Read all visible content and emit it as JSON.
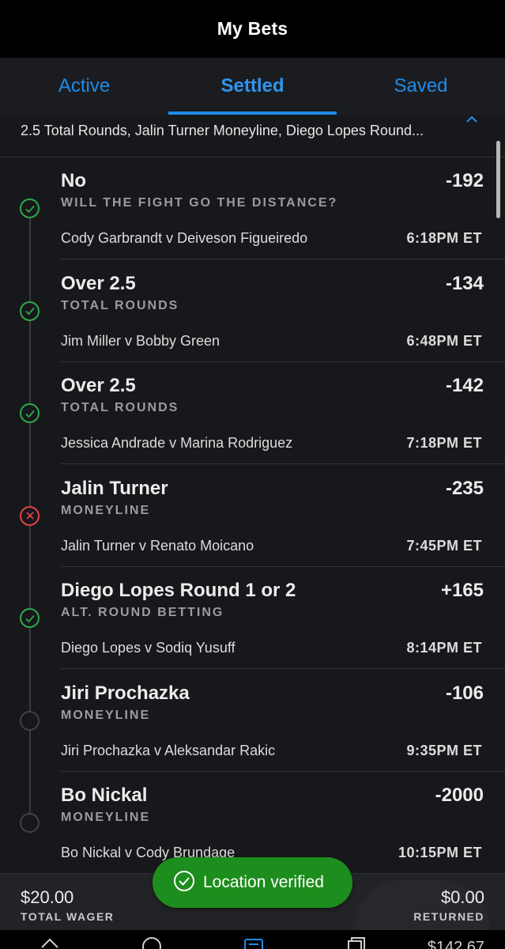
{
  "header": {
    "title": "My Bets"
  },
  "tabs": [
    {
      "label": "Active",
      "active": false
    },
    {
      "label": "Settled",
      "active": true
    },
    {
      "label": "Saved",
      "active": false
    }
  ],
  "summary": {
    "text": "2.5 Total Rounds, Jalin Turner Moneyline, Diego Lopes Round..."
  },
  "legs": [
    {
      "selection": "No",
      "market": "WILL THE FIGHT GO THE DISTANCE?",
      "odds": "-192",
      "event": "Cody Garbrandt v Deiveson Figueiredo",
      "time": "6:18PM ET",
      "status": "win"
    },
    {
      "selection": "Over 2.5",
      "market": "TOTAL ROUNDS",
      "odds": "-134",
      "event": "Jim Miller v Bobby Green",
      "time": "6:48PM ET",
      "status": "win"
    },
    {
      "selection": "Over 2.5",
      "market": "TOTAL ROUNDS",
      "odds": "-142",
      "event": "Jessica Andrade v Marina Rodriguez",
      "time": "7:18PM ET",
      "status": "win"
    },
    {
      "selection": "Jalin Turner",
      "market": "MONEYLINE",
      "odds": "-235",
      "event": "Jalin Turner v Renato Moicano",
      "time": "7:45PM ET",
      "status": "loss"
    },
    {
      "selection": "Diego Lopes Round 1 or 2",
      "market": "ALT. ROUND BETTING",
      "odds": "+165",
      "event": "Diego Lopes v Sodiq Yusuff",
      "time": "8:14PM ET",
      "status": "win"
    },
    {
      "selection": "Jiri Prochazka",
      "market": "MONEYLINE",
      "odds": "-106",
      "event": "Jiri Prochazka v Aleksandar Rakic",
      "time": "9:35PM ET",
      "status": "pending"
    },
    {
      "selection": "Bo Nickal",
      "market": "MONEYLINE",
      "odds": "-2000",
      "event": "Bo Nickal v Cody Brundage",
      "time": "10:15PM ET",
      "status": "pending"
    }
  ],
  "footer": {
    "wager_amount": "$20.00",
    "wager_label": "TOTAL WAGER",
    "returned_amount": "$0.00",
    "returned_label": "RETURNED"
  },
  "toast": {
    "text": "Location verified"
  },
  "bottom_nav": {
    "balance": "$142.67"
  },
  "colors": {
    "accent": "#1f8cea",
    "win": "#2ea84a",
    "loss": "#e04444",
    "toast": "#1d8d1d"
  }
}
